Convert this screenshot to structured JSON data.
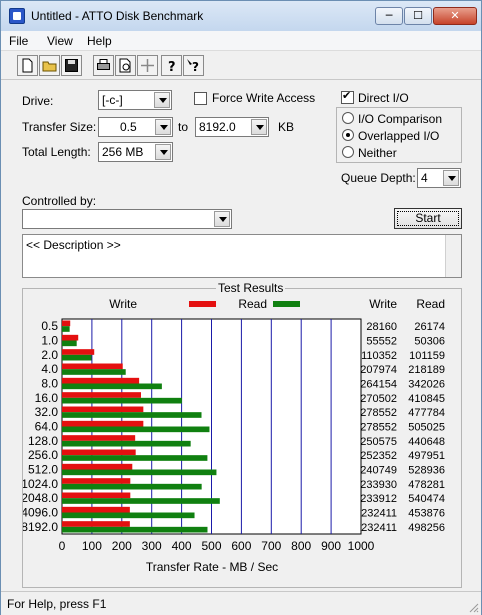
{
  "window": {
    "title": "Untitled - ATTO Disk Benchmark",
    "min_glyph": "─",
    "max_glyph": "☐",
    "close_glyph": "✕"
  },
  "menu": [
    "File",
    "View",
    "Help"
  ],
  "toolbar": [
    "new-icon",
    "open-icon",
    "save-icon",
    "print-icon",
    "print-preview-icon",
    "move-icon",
    "help-icon",
    "context-help-icon"
  ],
  "settings": {
    "drive_label": "Drive:",
    "drive_value": "[-c-]",
    "force_write_label": "Force Write Access",
    "force_write_checked": false,
    "direct_io_label": "Direct I/O",
    "direct_io_checked": true,
    "transfer_size_label": "Transfer Size:",
    "transfer_from": "0.5",
    "to_label": "to",
    "transfer_to": "8192.0",
    "unit_label": "KB",
    "total_length_label": "Total Length:",
    "total_length_value": "256 MB",
    "io_options": [
      "I/O Comparison",
      "Overlapped I/O",
      "Neither"
    ],
    "io_selected": 1,
    "queue_depth_label": "Queue Depth:",
    "queue_depth_value": "4",
    "controlled_by_label": "Controlled by:",
    "controlled_by_value": "",
    "start_label": "Start",
    "description": "<< Description >>"
  },
  "results": {
    "title": "Test Results",
    "legend_write": "Write",
    "legend_read": "Read",
    "col_write": "Write",
    "col_read": "Read",
    "xlabel": "Transfer Rate - MB / Sec"
  },
  "chart_data": {
    "type": "bar",
    "orientation": "horizontal",
    "title": "Test Results",
    "xlabel": "Transfer Rate - MB / Sec",
    "xlim": [
      0,
      1000
    ],
    "xticks": [
      0,
      100,
      200,
      300,
      400,
      500,
      600,
      700,
      800,
      900,
      1000
    ],
    "categories": [
      "0.5",
      "1.0",
      "2.0",
      "4.0",
      "8.0",
      "16.0",
      "32.0",
      "64.0",
      "128.0",
      "256.0",
      "512.0",
      "1024.0",
      "2048.0",
      "4096.0",
      "8192.0"
    ],
    "series": [
      {
        "name": "Write",
        "color": "#e41010",
        "values": [
          28160,
          55552,
          110352,
          207974,
          264154,
          270502,
          278552,
          278552,
          250575,
          252352,
          240749,
          233930,
          233912,
          232411,
          232411
        ]
      },
      {
        "name": "Read",
        "color": "#108010",
        "values": [
          26174,
          50306,
          101159,
          218189,
          342026,
          410845,
          477784,
          505025,
          440648,
          497951,
          528936,
          478281,
          540474,
          453876,
          498256
        ]
      }
    ],
    "value_unit_note": "bars plotted as value/1024 MB/s",
    "grid_color": "#1a1aa8"
  },
  "status": {
    "text": "For Help, press F1"
  }
}
